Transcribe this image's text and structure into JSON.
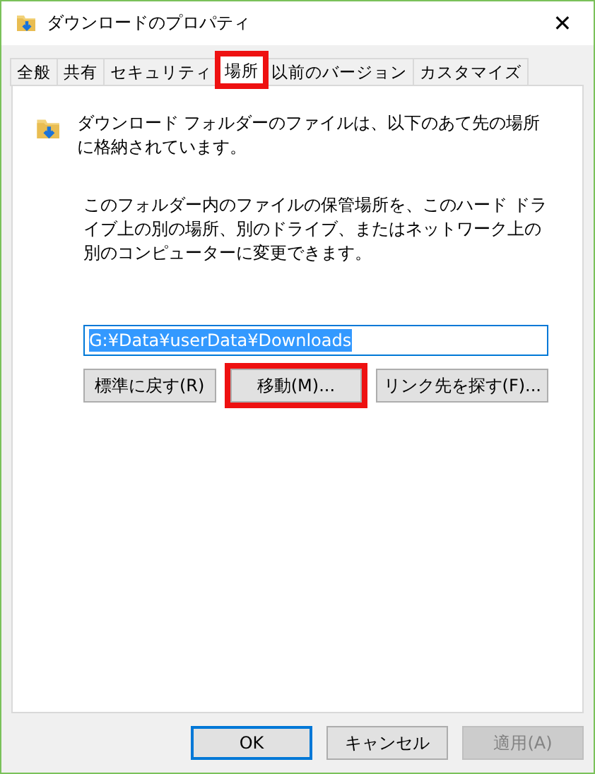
{
  "window": {
    "title": "ダウンロードのプロパティ",
    "close": "✕"
  },
  "tabs": [
    {
      "label": "全般",
      "selected": false,
      "highlighted": false
    },
    {
      "label": "共有",
      "selected": false,
      "highlighted": false
    },
    {
      "label": "セキュリティ",
      "selected": false,
      "highlighted": false
    },
    {
      "label": "場所",
      "selected": true,
      "highlighted": true
    },
    {
      "label": "以前のバージョン",
      "selected": false,
      "highlighted": false
    },
    {
      "label": "カスタマイズ",
      "selected": false,
      "highlighted": false
    }
  ],
  "location": {
    "message": "ダウンロード フォルダーのファイルは、以下のあて先の場所に格納されています。",
    "description": "このフォルダー内のファイルの保管場所を、このハード ドライブ上の別の場所、別のドライブ、またはネットワーク上の別のコンピューターに変更できます。",
    "path": "G:¥Data¥userData¥Downloads",
    "buttons": [
      {
        "label": "標準に戻す(R)",
        "highlighted": false
      },
      {
        "label": "移動(M)...",
        "highlighted": true
      },
      {
        "label": "リンク先を探す(F)...",
        "highlighted": false
      }
    ]
  },
  "footer_buttons": [
    {
      "label": "OK",
      "default": true,
      "disabled": false
    },
    {
      "label": "キャンセル",
      "default": false,
      "disabled": false
    },
    {
      "label": "適用(A)",
      "default": false,
      "disabled": true
    }
  ]
}
